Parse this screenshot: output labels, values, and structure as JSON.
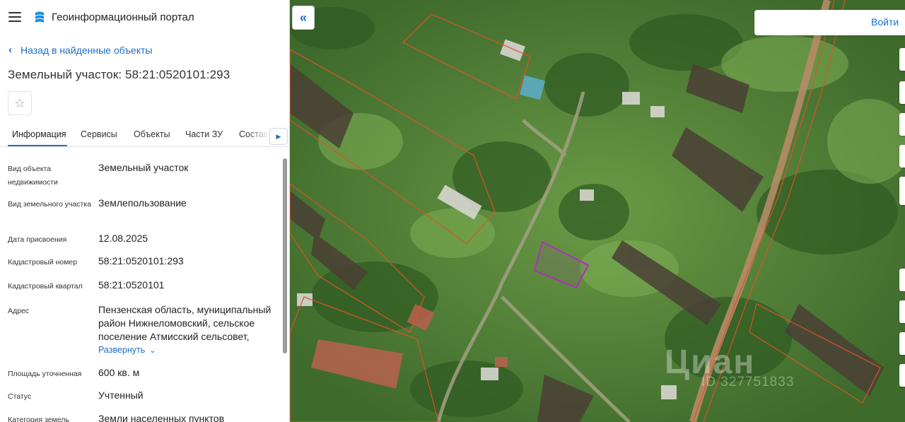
{
  "app": {
    "title": "Геоинформационный портал"
  },
  "nav": {
    "back_label": "Назад в найденные объекты"
  },
  "object": {
    "title": "Земельный участок: 58:21:0520101:293"
  },
  "tabs": [
    {
      "label": "Информация",
      "active": true
    },
    {
      "label": "Сервисы",
      "active": false
    },
    {
      "label": "Объекты",
      "active": false
    },
    {
      "label": "Части ЗУ",
      "active": false
    },
    {
      "label": "Состав",
      "active": false
    }
  ],
  "attributes": [
    {
      "label": "Вид объекта недвижимости",
      "value": "Земельный участок"
    },
    {
      "label": "Вид земельного участка",
      "value": "Землепользование"
    },
    {
      "label": "Дата присвоения",
      "value": "12.08.2025"
    },
    {
      "label": "Кадастровый номер",
      "value": "58:21:0520101:293"
    },
    {
      "label": "Кадастровый квартал",
      "value": "58:21:0520101"
    },
    {
      "label": "Адрес",
      "value": "Пензенская область, муниципальный район Нижнеломовский, сельское поселение Атмисский сельсовет,"
    },
    {
      "label": "Площадь уточненная",
      "value": "600 кв. м"
    },
    {
      "label": "Статус",
      "value": "Учтенный"
    },
    {
      "label": "Категория земель",
      "value": "Земли населенных пунктов"
    }
  ],
  "address_expand_label": "Развернуть",
  "map": {
    "login_label": "Войти",
    "watermark": "Циан",
    "watermark_id": "ID 327751833",
    "accent_color": "#1a6fc9",
    "selected_parcel_color": "#b02fc2",
    "parcel_border_color": "#e2502a"
  },
  "icons": {
    "menu": "menu-icon",
    "logo": "portal-logo-icon",
    "back": "chevron-left-icon",
    "favorite": "star-icon",
    "tabs_more": "caret-right-icon",
    "expand": "chevron-down-icon",
    "collapse": "double-chevron-left-icon"
  }
}
